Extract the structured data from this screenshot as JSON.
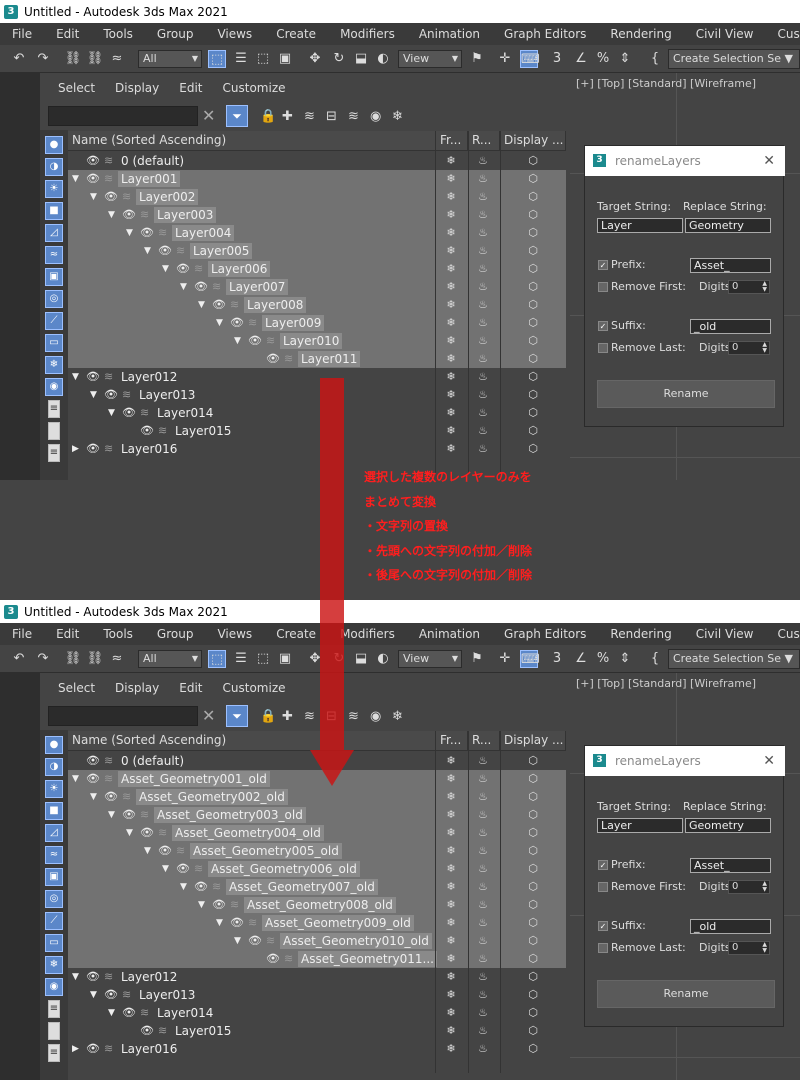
{
  "window_title": "Untitled - Autodesk 3ds Max 2021",
  "app_icon_label": "3",
  "menu": [
    "File",
    "Edit",
    "Tools",
    "Group",
    "Views",
    "Create",
    "Modifiers",
    "Animation",
    "Graph Editors",
    "Rendering",
    "Civil View",
    "Customize"
  ],
  "toolbar": {
    "filter_combo": "All",
    "view_combo": "View",
    "selection_set": "Create Selection Se"
  },
  "explorer": {
    "menu": [
      "Select",
      "Display",
      "Edit",
      "Customize"
    ],
    "columns": [
      "Name (Sorted Ascending)",
      "Fr...",
      "R...",
      "Display ..."
    ],
    "icon_glyphs": {
      "eye": "👁",
      "stack": "≋",
      "freeze": "❄",
      "render": "♨",
      "display": "⬡"
    }
  },
  "viewport_label": "[+] [Top] [Standard] [Wireframe]",
  "dialog": {
    "title": "renameLayers",
    "target_label": "Target String:",
    "replace_label": "Replace String:",
    "target_value": "Layer",
    "replace_value": "Geometry",
    "prefix_label": "Prefix:",
    "prefix_value": "Asset_",
    "remove_first_label": "Remove First:",
    "suffix_label": "Suffix:",
    "suffix_value": "_old",
    "remove_last_label": "Remove Last:",
    "digits_label": "Digits",
    "digits_value": "0",
    "button": "Rename"
  },
  "annotation": [
    "選択した複数のレイヤーのみを",
    "まとめて変換",
    "・文字列の置換",
    "・先頭への文字列の付加／削除",
    "・後尾への文字列の付加／削除"
  ],
  "layers_before": [
    {
      "name": "0 (default)",
      "depth": 0,
      "sel": false,
      "tog": ""
    },
    {
      "name": "Layer001",
      "depth": 0,
      "sel": true,
      "tog": "▼"
    },
    {
      "name": "Layer002",
      "depth": 1,
      "sel": true,
      "tog": "▼"
    },
    {
      "name": "Layer003",
      "depth": 2,
      "sel": true,
      "tog": "▼"
    },
    {
      "name": "Layer004",
      "depth": 3,
      "sel": true,
      "tog": "▼"
    },
    {
      "name": "Layer005",
      "depth": 4,
      "sel": true,
      "tog": "▼"
    },
    {
      "name": "Layer006",
      "depth": 5,
      "sel": true,
      "tog": "▼"
    },
    {
      "name": "Layer007",
      "depth": 6,
      "sel": true,
      "tog": "▼"
    },
    {
      "name": "Layer008",
      "depth": 7,
      "sel": true,
      "tog": "▼"
    },
    {
      "name": "Layer009",
      "depth": 8,
      "sel": true,
      "tog": "▼"
    },
    {
      "name": "Layer010",
      "depth": 9,
      "sel": true,
      "tog": "▼"
    },
    {
      "name": "Layer011",
      "depth": 10,
      "sel": true,
      "tog": ""
    },
    {
      "name": "Layer012",
      "depth": 0,
      "sel": false,
      "tog": "▼"
    },
    {
      "name": "Layer013",
      "depth": 1,
      "sel": false,
      "tog": "▼"
    },
    {
      "name": "Layer014",
      "depth": 2,
      "sel": false,
      "tog": "▼"
    },
    {
      "name": "Layer015",
      "depth": 3,
      "sel": false,
      "tog": ""
    },
    {
      "name": "Layer016",
      "depth": 0,
      "sel": false,
      "tog": "▶"
    }
  ],
  "layers_after": [
    {
      "name": "0 (default)",
      "depth": 0,
      "sel": false,
      "tog": ""
    },
    {
      "name": "Asset_Geometry001_old",
      "depth": 0,
      "sel": true,
      "tog": "▼"
    },
    {
      "name": "Asset_Geometry002_old",
      "depth": 1,
      "sel": true,
      "tog": "▼"
    },
    {
      "name": "Asset_Geometry003_old",
      "depth": 2,
      "sel": true,
      "tog": "▼"
    },
    {
      "name": "Asset_Geometry004_old",
      "depth": 3,
      "sel": true,
      "tog": "▼"
    },
    {
      "name": "Asset_Geometry005_old",
      "depth": 4,
      "sel": true,
      "tog": "▼"
    },
    {
      "name": "Asset_Geometry006_old",
      "depth": 5,
      "sel": true,
      "tog": "▼"
    },
    {
      "name": "Asset_Geometry007_old",
      "depth": 6,
      "sel": true,
      "tog": "▼"
    },
    {
      "name": "Asset_Geometry008_old",
      "depth": 7,
      "sel": true,
      "tog": "▼"
    },
    {
      "name": "Asset_Geometry009_old",
      "depth": 8,
      "sel": true,
      "tog": "▼"
    },
    {
      "name": "Asset_Geometry010_old",
      "depth": 9,
      "sel": true,
      "tog": "▼"
    },
    {
      "name": "Asset_Geometry011...",
      "depth": 10,
      "sel": true,
      "tog": ""
    },
    {
      "name": "Layer012",
      "depth": 0,
      "sel": false,
      "tog": "▼"
    },
    {
      "name": "Layer013",
      "depth": 1,
      "sel": false,
      "tog": "▼"
    },
    {
      "name": "Layer014",
      "depth": 2,
      "sel": false,
      "tog": "▼"
    },
    {
      "name": "Layer015",
      "depth": 3,
      "sel": false,
      "tog": ""
    },
    {
      "name": "Layer016",
      "depth": 0,
      "sel": false,
      "tog": "▶"
    }
  ]
}
